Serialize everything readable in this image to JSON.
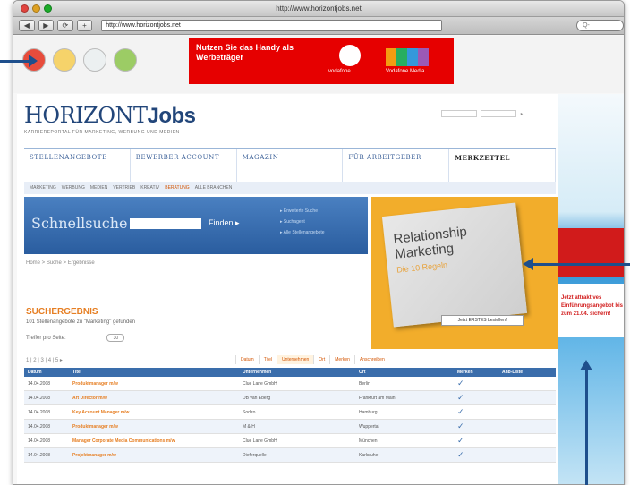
{
  "window": {
    "title": "http://www.horizontjobs.net",
    "url": "http://www.horizontjobs.net",
    "search_placeholder": "Q-",
    "buttons": [
      "◀",
      "▶",
      "⟳",
      "+"
    ]
  },
  "top_ad": {
    "headline": "Nutzen Sie das Handy als Werbeträger",
    "brand": "vodafone",
    "brand2": "Vodafone Media"
  },
  "site": {
    "logo_prefix": "HORIZONT",
    "logo_suffix": "Jobs",
    "tagline": "KARRIEREPORTAL FÜR MARKETING, WERBUNG UND MEDIEN",
    "login_labels": [
      "Benutzer",
      "Passwort"
    ]
  },
  "nav": {
    "items": [
      "STELLENANGEBOTE",
      "BEWERBER ACCOUNT",
      "MAGAZIN",
      "FÜR ARBEITGEBER",
      "MERKZETTEL"
    ],
    "login_tab": "MERKZETTEL"
  },
  "subnav": [
    "MARKETING",
    "WERBUNG",
    "MEDIEN",
    "VERTRIEB",
    "KREATIV",
    "BERATUNG",
    "ALLE BRANCHEN"
  ],
  "schnellsuche": {
    "title": "Schnellsuche",
    "go_label": "Finden ▸",
    "links": [
      "▸ Erweiterte Suche",
      "▸ Suchagent",
      "▸ Alle Stellenangebote"
    ]
  },
  "breadcrumb": "Home > Suche > Ergebnisse",
  "promo": {
    "book_title": "Relationship Marketing",
    "book_sub": "Die 10 Regeln",
    "button": "Jetzt ERSTES bestellen!"
  },
  "results": {
    "title": "SUCHERGEBNIS",
    "subtitle": "101 Stellenangebote zu \"Marketing\" gefunden",
    "per_page_label": "Treffer pro Seite:",
    "per_page_value": "30",
    "pager": "1 | 2 | 3 | 4 | 5 ▸",
    "sort_tabs": [
      "Datum",
      "Titel",
      "Unternehmen",
      "Ort",
      "Merken",
      "Anschreiben"
    ],
    "columns": [
      "Datum",
      "Titel",
      "Unternehmen",
      "Ort",
      "Merken",
      "Anb-Liste"
    ],
    "rows": [
      [
        "14.04.2008",
        "Produktmanager m/w",
        "Clue Lane GmbH",
        "Berlin",
        "✓",
        ""
      ],
      [
        "14.04.2008",
        "Art Director m/w",
        "DB van Eberg",
        "Frankfurt am Main",
        "✓",
        ""
      ],
      [
        "14.04.2008",
        "Key Account Manager m/w",
        "Sodiro",
        "Hamburg",
        "✓",
        ""
      ],
      [
        "14.04.2008",
        "Produktmanager m/w",
        "M & H",
        "Wuppertal",
        "✓",
        ""
      ],
      [
        "14.04.2008",
        "Manager Corporate Media Communications m/w",
        "Clue Lane GmbH",
        "München",
        "✓",
        ""
      ],
      [
        "14.04.2008",
        "Projektmanager m/w",
        "Dieferquelle",
        "Karlsruhe",
        "✓",
        ""
      ]
    ]
  },
  "sidebar_ad": {
    "text": "Jetzt attraktives Einführungsangebot bis zum 21.04. sichern!"
  },
  "colors": {
    "brand_blue": "#22467a",
    "accent_orange": "#e67e22",
    "vodafone_red": "#e60000",
    "arrow_blue": "#1e4f8c"
  }
}
